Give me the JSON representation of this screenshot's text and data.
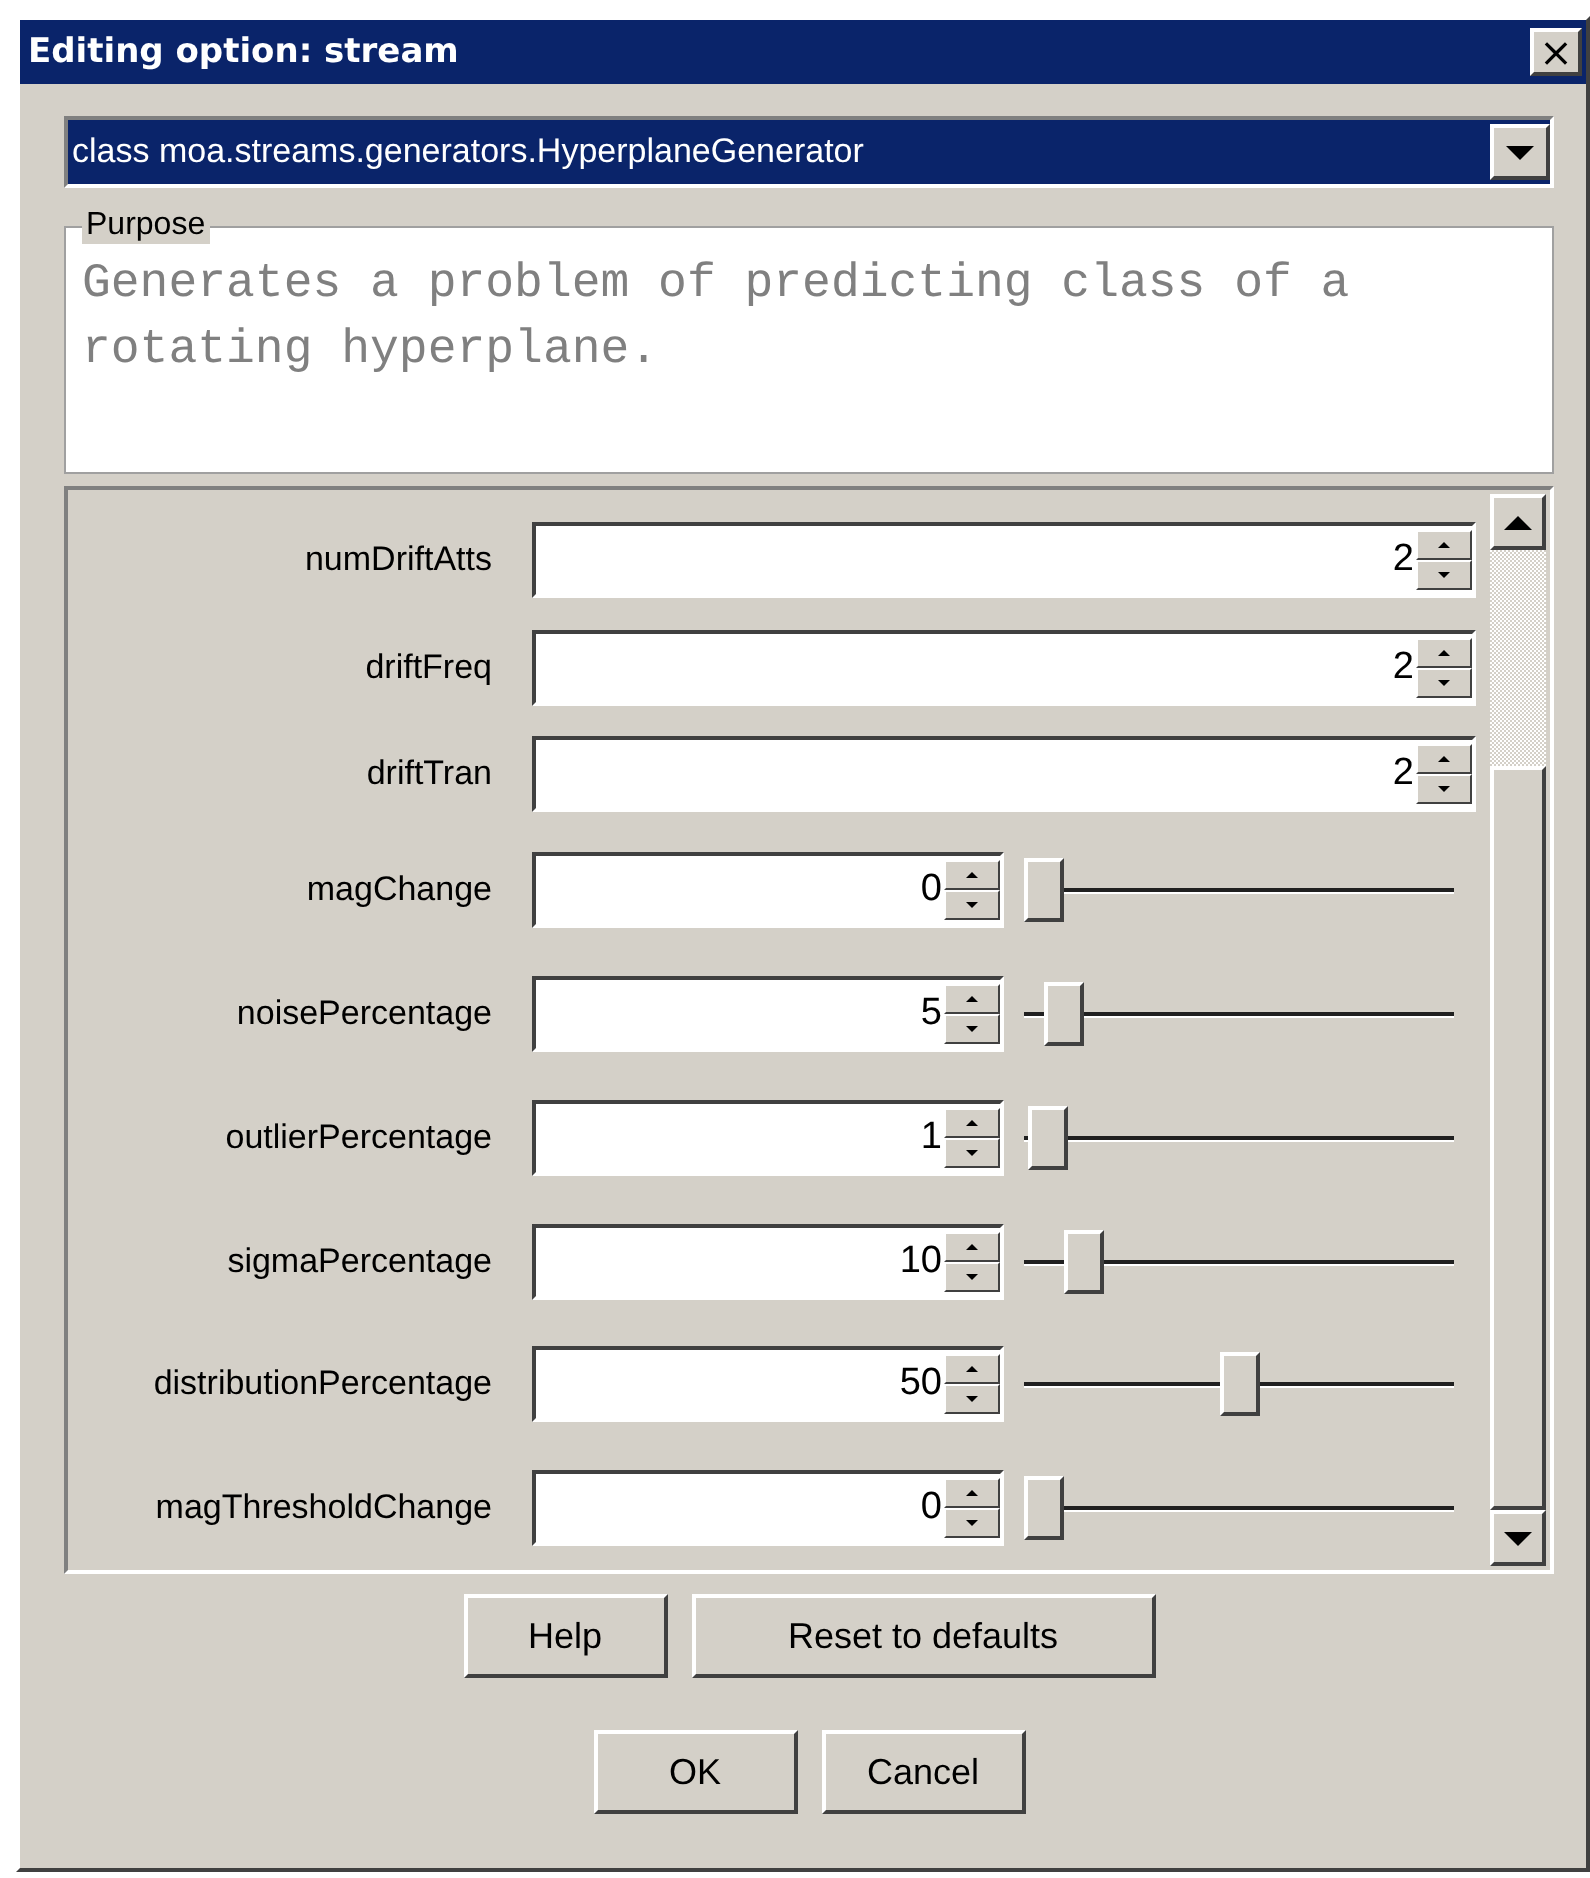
{
  "window": {
    "title": "Editing option: stream",
    "close": "×"
  },
  "class_select": {
    "value": "class moa.streams.generators.HyperplaneGenerator"
  },
  "purpose": {
    "legend": "Purpose",
    "text": "Generates a problem of predicting class of a rotating hyperplane."
  },
  "options": [
    {
      "kind": "spinner",
      "label": "numDriftAtts",
      "value": "2"
    },
    {
      "kind": "spinner",
      "label": "driftFreq",
      "value": "2"
    },
    {
      "kind": "spinner",
      "label": "driftTran",
      "value": "2"
    },
    {
      "kind": "slider",
      "label": "magChange",
      "value": "0",
      "level": 0
    },
    {
      "kind": "slider",
      "label": "noisePercentage",
      "value": "5",
      "level": 0.05
    },
    {
      "kind": "slider",
      "label": "outlierPercentage",
      "value": "1",
      "level": 0.01
    },
    {
      "kind": "slider",
      "label": "sigmaPercentage",
      "value": "10",
      "level": 0.1
    },
    {
      "kind": "slider",
      "label": "distributionPercentage",
      "value": "50",
      "level": 0.5
    },
    {
      "kind": "slider",
      "label": "magThresholdChange",
      "value": "0",
      "level": 0
    }
  ],
  "buttons_row_1": [
    "Help",
    "Reset to defaults"
  ],
  "buttons_row_2": [
    "OK",
    "Cancel"
  ]
}
